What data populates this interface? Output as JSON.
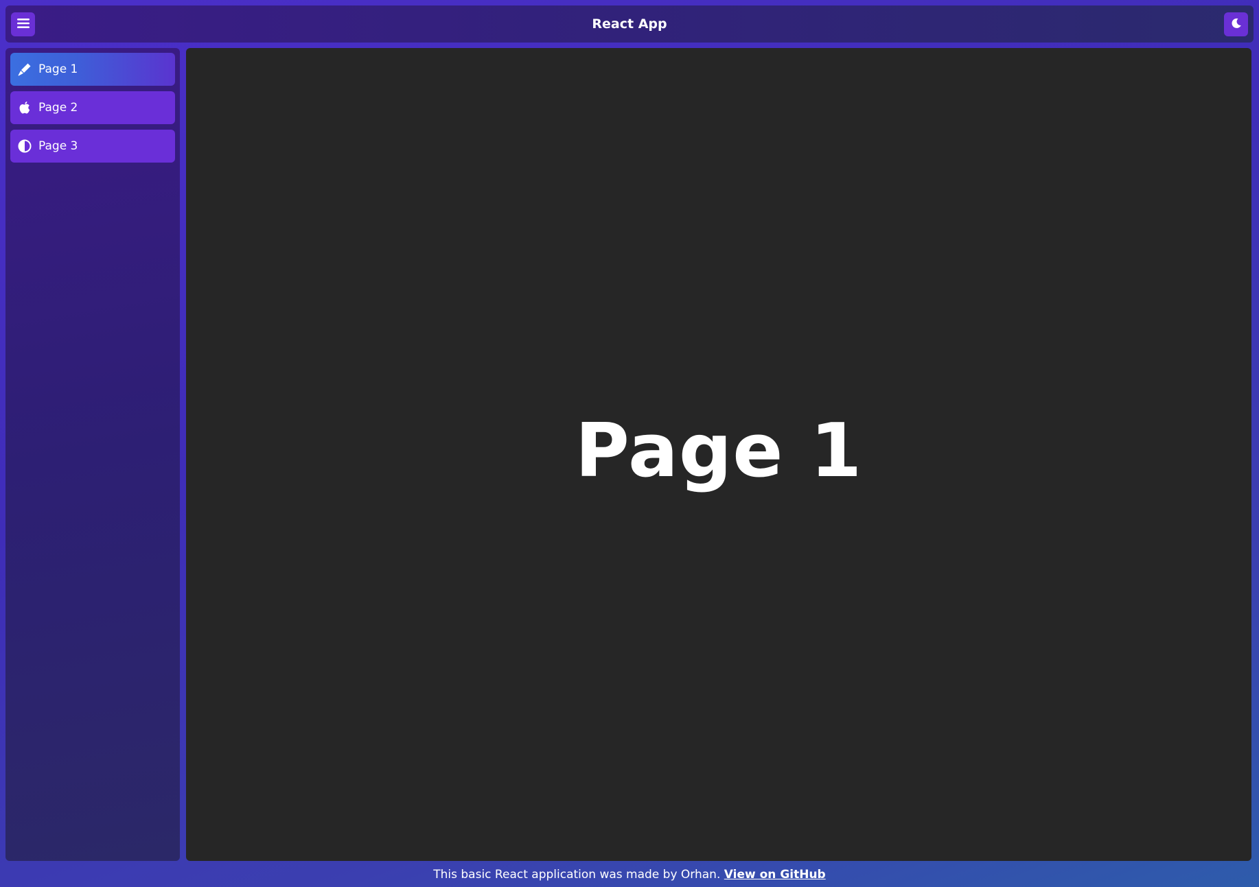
{
  "header": {
    "title": "React App",
    "menu_icon": "hamburger-menu-icon",
    "theme_icon": "moon-icon"
  },
  "sidebar": {
    "items": [
      {
        "label": "Page 1",
        "icon": "pen-icon",
        "active": true
      },
      {
        "label": "Page 2",
        "icon": "apple-icon",
        "active": false
      },
      {
        "label": "Page 3",
        "icon": "contrast-icon",
        "active": false
      }
    ]
  },
  "main": {
    "heading": "Page 1"
  },
  "footer": {
    "text": "This basic React application was made by Orhan.",
    "link_label": "View on GitHub"
  },
  "colors": {
    "accent": "#6a30d6",
    "content_bg": "#262626",
    "header_bg": "#31227a"
  }
}
